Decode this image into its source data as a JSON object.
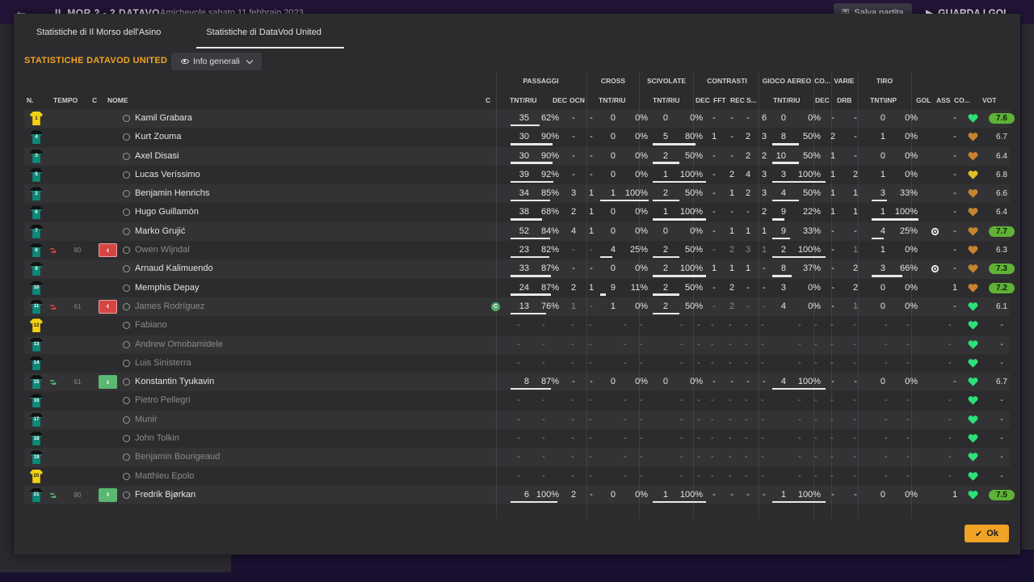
{
  "background": {
    "score": "IL MOR  2 - 2  DATAVO",
    "meta": "Amichevole      sabato 11 febbraio 2023",
    "save_label": "Salva partita",
    "continue_label": "GUARDA I GOL"
  },
  "tabs": [
    {
      "label": "Statistiche di Il Morso dell'Asino",
      "active": false
    },
    {
      "label": "Statistiche di DataVod United",
      "active": true
    }
  ],
  "team_title": "STATISTICHE DATAVOD UNITED",
  "view_select": "Info generali",
  "group_headers": [
    "PASSAGGI",
    "CROSS",
    "SCIVOLATE",
    "CONTRASTI",
    "GIOCO AEREO",
    "CO...",
    "VARIE",
    "TIRO"
  ],
  "column_headers": {
    "num": "N.",
    "time": "TEMPO",
    "c1": "C",
    "name": "NOME",
    "c2": "C",
    "pass_tnt": "TNT/RIU",
    "pass_dec": "DEC",
    "pass_ocn": "OCN",
    "cross_tnt": "TNT/RIU",
    "tack_tnt": "TNT/RIU",
    "con_dec": "DEC",
    "con_fft": "FFT",
    "con_rec": "REC",
    "con_s": "S...",
    "air_tnt": "TNT/RIU",
    "co_dec": "DEC",
    "var_drb": "DRB",
    "shot": "TNT\\INP",
    "gol": "GOL",
    "ass": "ASS",
    "co": "CO...",
    "vot": "VOT"
  },
  "colors": {
    "accent": "#f0a324",
    "sub_out": "#d64545",
    "sub_in": "#5bb870",
    "rating_good": "#5fb236",
    "heart_green": "#2ee07a",
    "heart_orange": "#c7832f",
    "heart_yellow": "#e0c02a"
  },
  "players": [
    {
      "n": "1",
      "gk": true,
      "name": "Kamil Grabara",
      "played": true,
      "pass": [
        "35",
        "62%"
      ],
      "pass_pct": 62,
      "dec": "-",
      "ocn": "-",
      "cross": [
        "0",
        "0%"
      ],
      "cross_pct": 0,
      "tack": [
        "0",
        "0%"
      ],
      "tack_pct": 0,
      "c": [
        "-",
        "-",
        "-",
        "6"
      ],
      "air": [
        "0",
        "0%"
      ],
      "air_pct": 0,
      "co_dec": "-",
      "drb": "-",
      "shot": [
        "0",
        "0%"
      ],
      "shot_pct": 0,
      "gol": "",
      "ass": "-",
      "heart": "green",
      "vot": "7.6",
      "vot_good": true
    },
    {
      "n": "4",
      "name": "Kurt Zouma",
      "played": true,
      "pass": [
        "30",
        "90%"
      ],
      "pass_pct": 90,
      "dec": "-",
      "ocn": "-",
      "cross": [
        "0",
        "0%"
      ],
      "cross_pct": 0,
      "tack": [
        "5",
        "80%"
      ],
      "tack_pct": 80,
      "c": [
        "1",
        "-",
        "2",
        "3"
      ],
      "air": [
        "8",
        "50%"
      ],
      "air_pct": 50,
      "co_dec": "2",
      "drb": "-",
      "shot": [
        "1",
        "0%"
      ],
      "shot_pct": 0,
      "gol": "",
      "ass": "-",
      "heart": "orange",
      "vot": "6.7"
    },
    {
      "n": "3",
      "name": "Axel Disasi",
      "played": true,
      "pass": [
        "30",
        "90%"
      ],
      "pass_pct": 90,
      "dec": "-",
      "ocn": "-",
      "cross": [
        "0",
        "0%"
      ],
      "cross_pct": 0,
      "tack": [
        "2",
        "50%"
      ],
      "tack_pct": 50,
      "c": [
        "-",
        "-",
        "2",
        "2"
      ],
      "air": [
        "10",
        "50%"
      ],
      "air_pct": 50,
      "co_dec": "1",
      "drb": "-",
      "shot": [
        "0",
        "0%"
      ],
      "shot_pct": 0,
      "gol": "",
      "ass": "-",
      "heart": "orange",
      "vot": "6.4"
    },
    {
      "n": "5",
      "name": "Lucas Veríssimo",
      "played": true,
      "pass": [
        "39",
        "92%"
      ],
      "pass_pct": 92,
      "dec": "-",
      "ocn": "-",
      "cross": [
        "0",
        "0%"
      ],
      "cross_pct": 0,
      "tack": [
        "1",
        "100%"
      ],
      "tack_pct": 100,
      "c": [
        "-",
        "2",
        "4",
        "3"
      ],
      "air": [
        "3",
        "100%"
      ],
      "air_pct": 100,
      "co_dec": "1",
      "drb": "2",
      "shot": [
        "1",
        "0%"
      ],
      "shot_pct": 0,
      "gol": "",
      "ass": "-",
      "heart": "yellow",
      "vot": "6.8"
    },
    {
      "n": "2",
      "name": "Benjamin Henrichs",
      "played": true,
      "pass": [
        "34",
        "85%"
      ],
      "pass_pct": 85,
      "dec": "3",
      "ocn": "1",
      "cross": [
        "1",
        "100%"
      ],
      "cross_pct": 100,
      "tack": [
        "2",
        "50%"
      ],
      "tack_pct": 50,
      "c": [
        "-",
        "1",
        "2",
        "3"
      ],
      "air": [
        "4",
        "50%"
      ],
      "air_pct": 50,
      "co_dec": "1",
      "drb": "1",
      "shot": [
        "3",
        "33%"
      ],
      "shot_pct": 33,
      "gol": "",
      "ass": "-",
      "heart": "orange",
      "vot": "6.6"
    },
    {
      "n": "6",
      "name": "Hugo Guillamón",
      "played": true,
      "pass": [
        "38",
        "68%"
      ],
      "pass_pct": 68,
      "dec": "2",
      "ocn": "1",
      "cross": [
        "0",
        "0%"
      ],
      "cross_pct": 0,
      "tack": [
        "1",
        "100%"
      ],
      "tack_pct": 100,
      "c": [
        "-",
        "-",
        "-",
        "2"
      ],
      "air": [
        "9",
        "22%"
      ],
      "air_pct": 22,
      "co_dec": "1",
      "drb": "1",
      "shot": [
        "1",
        "100%"
      ],
      "shot_pct": 100,
      "gol": "",
      "ass": "-",
      "heart": "orange",
      "vot": "6.4"
    },
    {
      "n": "7",
      "name": "Marko Grujić",
      "played": true,
      "pass": [
        "52",
        "84%"
      ],
      "pass_pct": 84,
      "dec": "4",
      "ocn": "1",
      "cross": [
        "0",
        "0%"
      ],
      "cross_pct": 0,
      "tack": [
        "0",
        "0%"
      ],
      "tack_pct": 0,
      "c": [
        "-",
        "1",
        "1",
        "1"
      ],
      "air": [
        "9",
        "33%"
      ],
      "air_pct": 33,
      "co_dec": "-",
      "drb": "-",
      "shot": [
        "4",
        "25%"
      ],
      "shot_pct": 25,
      "gol": "gear",
      "ass": "-",
      "heart": "orange",
      "vot": "7.7",
      "vot_good": true
    },
    {
      "n": "8",
      "name": "Owen Wijndal",
      "played": true,
      "subbed_out": "80",
      "pass": [
        "23",
        "82%"
      ],
      "pass_pct": 82,
      "dec": "-",
      "ocn": "-",
      "cross": [
        "4",
        "25%"
      ],
      "cross_pct": 25,
      "tack": [
        "2",
        "50%"
      ],
      "tack_pct": 50,
      "c": [
        "-",
        "2",
        "3",
        "1"
      ],
      "air": [
        "2",
        "100%"
      ],
      "air_pct": 100,
      "co_dec": "-",
      "drb": "1",
      "shot": [
        "1",
        "0%"
      ],
      "shot_pct": 0,
      "gol": "",
      "ass": "-",
      "heart": "orange",
      "vot": "6.3",
      "dim": true
    },
    {
      "n": "9",
      "name": "Arnaud Kalimuendo",
      "played": true,
      "pass": [
        "33",
        "87%"
      ],
      "pass_pct": 87,
      "dec": "-",
      "ocn": "-",
      "cross": [
        "0",
        "0%"
      ],
      "cross_pct": 0,
      "tack": [
        "2",
        "100%"
      ],
      "tack_pct": 100,
      "c": [
        "1",
        "1",
        "1",
        "-"
      ],
      "air": [
        "8",
        "37%"
      ],
      "air_pct": 37,
      "co_dec": "-",
      "drb": "2",
      "shot": [
        "3",
        "66%"
      ],
      "shot_pct": 66,
      "gol": "gear",
      "ass": "-",
      "heart": "orange",
      "vot": "7.3",
      "vot_good": true
    },
    {
      "n": "10",
      "name": "Memphis Depay",
      "played": true,
      "pass": [
        "24",
        "87%"
      ],
      "pass_pct": 87,
      "dec": "2",
      "ocn": "1",
      "cross": [
        "9",
        "11%"
      ],
      "cross_pct": 11,
      "tack": [
        "2",
        "50%"
      ],
      "tack_pct": 50,
      "c": [
        "-",
        "2",
        "-",
        "-"
      ],
      "air": [
        "3",
        "0%"
      ],
      "air_pct": 0,
      "co_dec": "-",
      "drb": "2",
      "shot": [
        "0",
        "0%"
      ],
      "shot_pct": 0,
      "gol": "",
      "ass": "1",
      "heart": "orange",
      "vot": "7.2",
      "vot_good": true
    },
    {
      "n": "11",
      "name": "James Rodríguez",
      "played": true,
      "subbed_out": "61",
      "captain": true,
      "pass": [
        "13",
        "76%"
      ],
      "pass_pct": 76,
      "dec": "1",
      "ocn": "-",
      "cross": [
        "1",
        "0%"
      ],
      "cross_pct": 0,
      "tack": [
        "2",
        "50%"
      ],
      "tack_pct": 50,
      "c": [
        "-",
        "2",
        "-",
        "-"
      ],
      "air": [
        "4",
        "0%"
      ],
      "air_pct": 0,
      "co_dec": "-",
      "drb": "1",
      "shot": [
        "0",
        "0%"
      ],
      "shot_pct": 0,
      "gol": "",
      "ass": "-",
      "heart": "green",
      "vot": "6.1",
      "dim": true
    },
    {
      "n": "12",
      "gk": true,
      "name": "Fabiano",
      "played": false,
      "heart": "green",
      "vot": "-"
    },
    {
      "n": "13",
      "name": "Andrew Omobamidele",
      "played": false,
      "heart": "green",
      "vot": "-"
    },
    {
      "n": "14",
      "name": "Luis Sinisterra",
      "played": false,
      "heart": "green",
      "vot": "-"
    },
    {
      "n": "15",
      "name": "Konstantin Tyukavin",
      "played": true,
      "subbed_in": "61",
      "pass": [
        "8",
        "87%"
      ],
      "pass_pct": 87,
      "dec": "-",
      "ocn": "-",
      "cross": [
        "0",
        "0%"
      ],
      "cross_pct": 0,
      "tack": [
        "0",
        "0%"
      ],
      "tack_pct": 0,
      "c": [
        "-",
        "-",
        "-",
        "-"
      ],
      "air": [
        "4",
        "100%"
      ],
      "air_pct": 100,
      "co_dec": "-",
      "drb": "-",
      "shot": [
        "0",
        "0%"
      ],
      "shot_pct": 0,
      "gol": "",
      "ass": "-",
      "heart": "green",
      "vot": "6.7"
    },
    {
      "n": "16",
      "name": "Pietro Pellegri",
      "played": false,
      "heart": "green",
      "vot": "-"
    },
    {
      "n": "17",
      "name": "Munir",
      "played": false,
      "heart": "green",
      "vot": "-"
    },
    {
      "n": "18",
      "name": "John Tolkin",
      "played": false,
      "heart": "green",
      "vot": "-"
    },
    {
      "n": "19",
      "name": "Benjamin Bourigeaud",
      "played": false,
      "heart": "green",
      "vot": "-"
    },
    {
      "n": "20",
      "gk": true,
      "name": "Matthieu Epolo",
      "played": false,
      "heart": "green",
      "vot": "-"
    },
    {
      "n": "21",
      "name": "Fredrik Bjørkan",
      "played": true,
      "subbed_in": "80",
      "pass": [
        "6",
        "100%"
      ],
      "pass_pct": 100,
      "dec": "2",
      "ocn": "-",
      "cross": [
        "0",
        "0%"
      ],
      "cross_pct": 0,
      "tack": [
        "1",
        "100%"
      ],
      "tack_pct": 100,
      "c": [
        "-",
        "-",
        "-",
        "-"
      ],
      "air": [
        "1",
        "100%"
      ],
      "air_pct": 100,
      "co_dec": "-",
      "drb": "-",
      "shot": [
        "0",
        "0%"
      ],
      "shot_pct": 0,
      "gol": "",
      "ass": "1",
      "heart": "green",
      "vot": "7.5",
      "vot_good": true
    }
  ],
  "ok_label": "Ok"
}
